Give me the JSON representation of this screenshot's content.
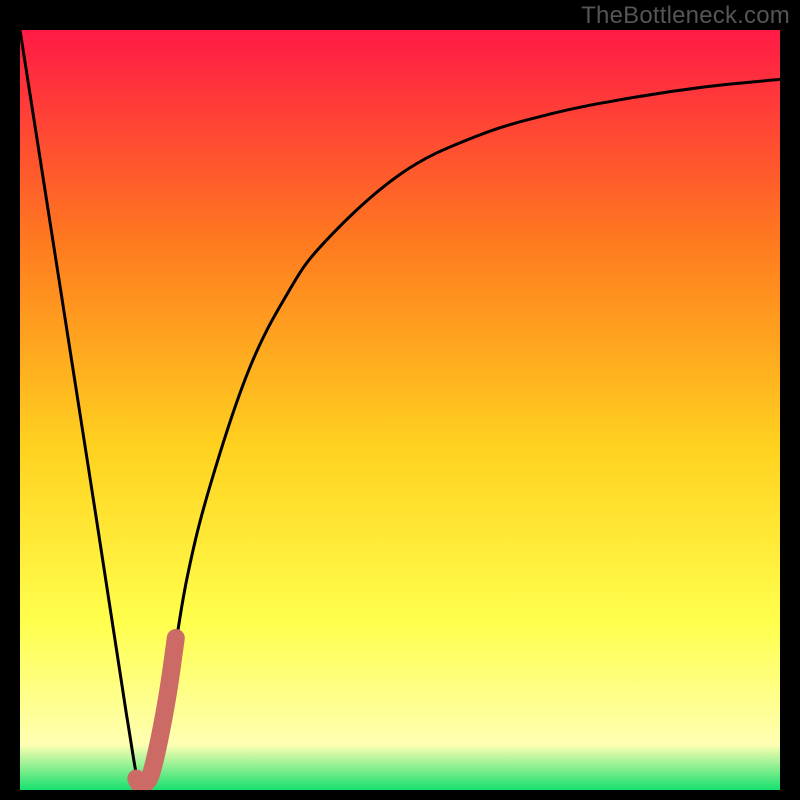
{
  "watermark": "TheBottleneck.com",
  "colors": {
    "bg_black": "#000000",
    "grad_top": "#ff1a46",
    "grad_mid1": "#ff7a1f",
    "grad_mid2": "#ffd21f",
    "grad_mid3": "#ffff4d",
    "grad_bottom_yellow": "#ffffb2",
    "grad_bottom_green": "#18e070",
    "curve": "#000000",
    "marker": "#cc6b66"
  },
  "chart_data": {
    "type": "line",
    "title": "",
    "xlabel": "",
    "ylabel": "",
    "xlim": [
      0,
      100
    ],
    "ylim": [
      0,
      100
    ],
    "series": [
      {
        "name": "bottleneck-curve",
        "x": [
          0,
          5,
          10,
          14,
          16,
          18,
          20,
          22,
          25,
          30,
          35,
          40,
          50,
          60,
          70,
          80,
          90,
          100
        ],
        "y": [
          100,
          68,
          36,
          10,
          0,
          4,
          16,
          28,
          40,
          55,
          65,
          72,
          81,
          86,
          89,
          91,
          92.5,
          93.5
        ]
      }
    ],
    "marker": {
      "name": "highlight-segment",
      "x": [
        15.3,
        15.7,
        16.3,
        17.2,
        18.3,
        19.5,
        20.5
      ],
      "y": [
        1.5,
        0.8,
        0.8,
        2.0,
        6.5,
        13.0,
        20.0
      ]
    }
  }
}
